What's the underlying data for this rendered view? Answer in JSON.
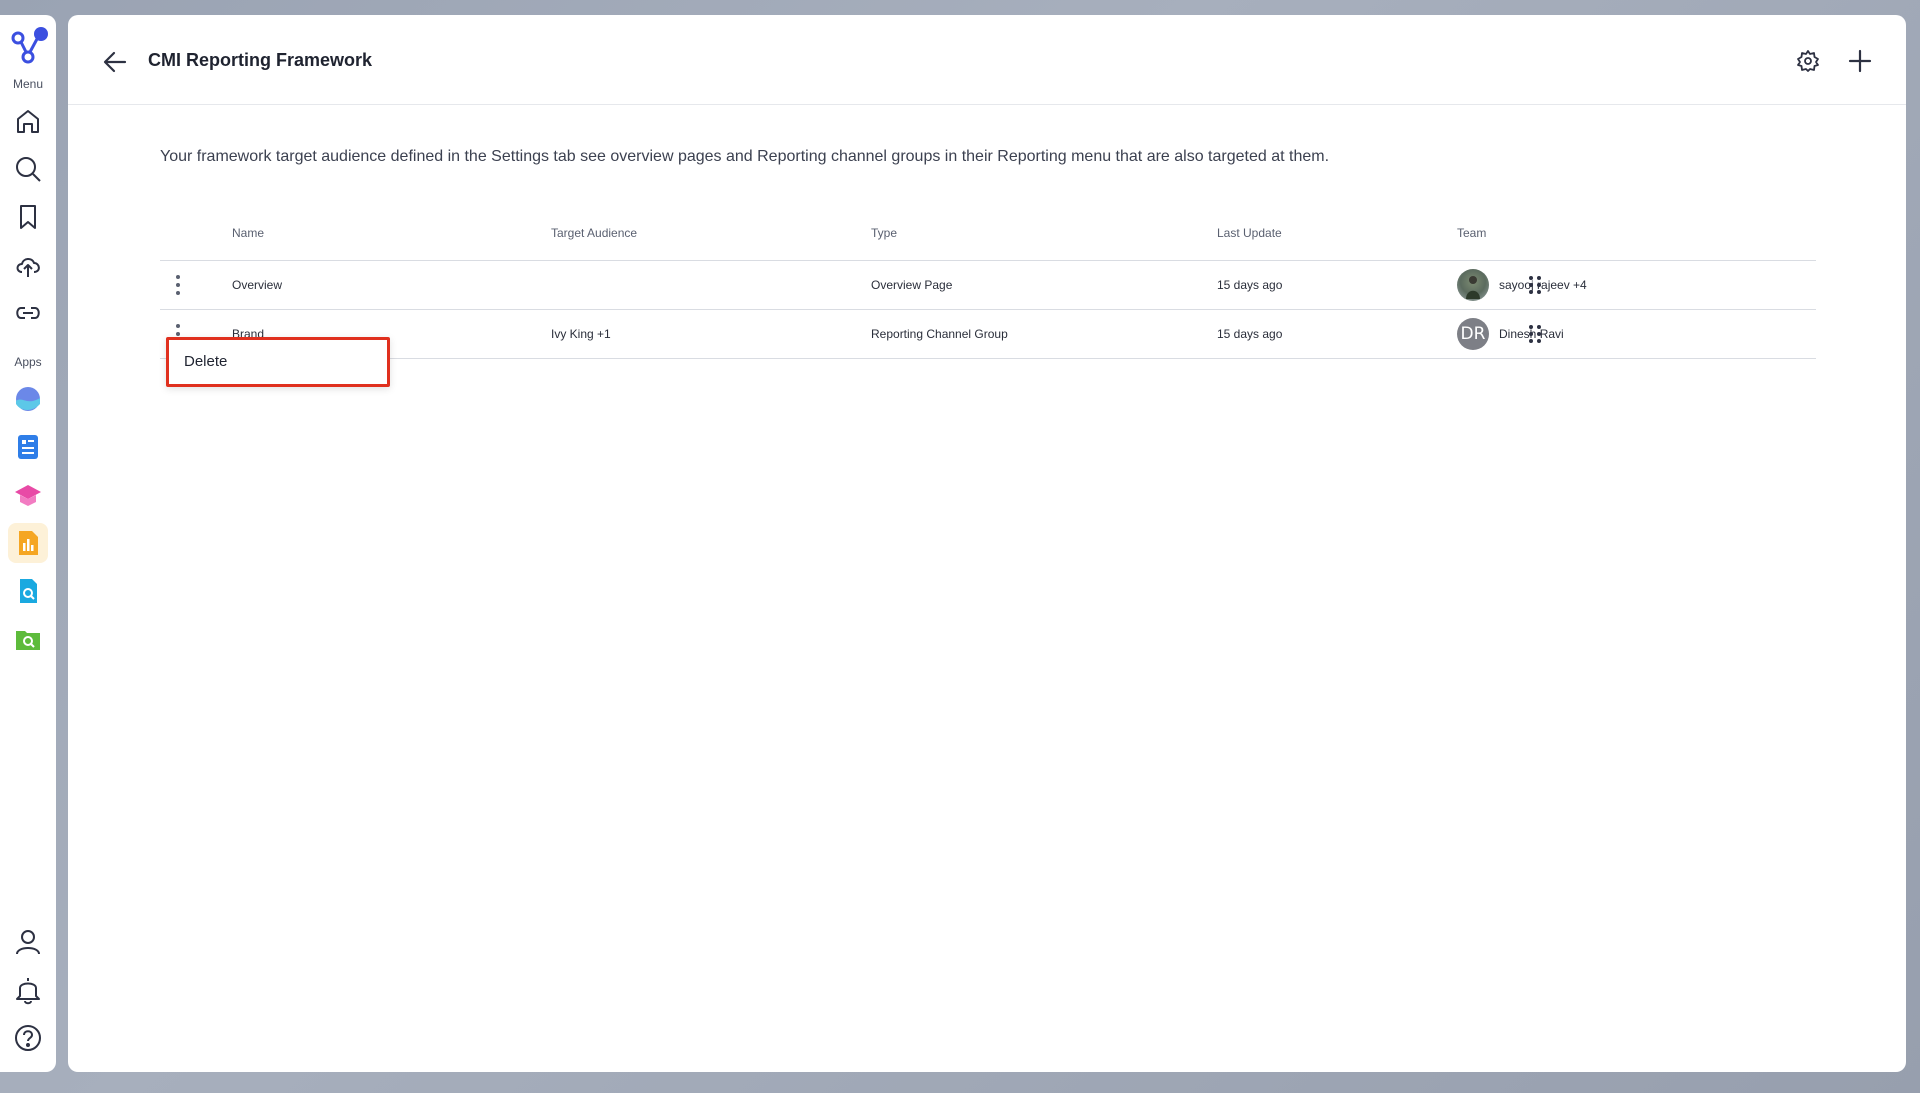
{
  "sidebar": {
    "menu_label": "Menu",
    "apps_label": "Apps",
    "menu_items": [
      "home-icon",
      "search-icon",
      "bookmark-icon",
      "upload-cloud-icon",
      "link-icon"
    ],
    "app_items": [
      "wave-app-icon",
      "document-app-icon",
      "education-app-icon",
      "reporting-app-icon",
      "file-search-app-icon",
      "folder-search-app-icon"
    ],
    "bottom_items": [
      "user-icon",
      "bell-icon",
      "help-icon"
    ],
    "brand_color": "#3b4fe0"
  },
  "header": {
    "title": "CMI Reporting Framework"
  },
  "description": "Your framework target audience defined in the Settings tab see overview pages and Reporting channel groups in their Reporting menu that are also targeted at them.",
  "table": {
    "columns": {
      "name": "Name",
      "audience": "Target Audience",
      "type": "Type",
      "updated": "Last Update",
      "team": "Team"
    },
    "rows": [
      {
        "name": "Overview",
        "audience": "",
        "type": "Overview Page",
        "updated": "15 days ago",
        "team": "sayooj rajeev +4",
        "avatar": "photo"
      },
      {
        "name": "Brand",
        "audience": "Ivy King +1",
        "type": "Reporting Channel Group",
        "updated": "15 days ago",
        "team": "Dinesh Ravi",
        "avatar_initials": "DR"
      }
    ]
  },
  "context_menu": {
    "delete_label": "Delete",
    "highlight_color": "#e0301e"
  }
}
